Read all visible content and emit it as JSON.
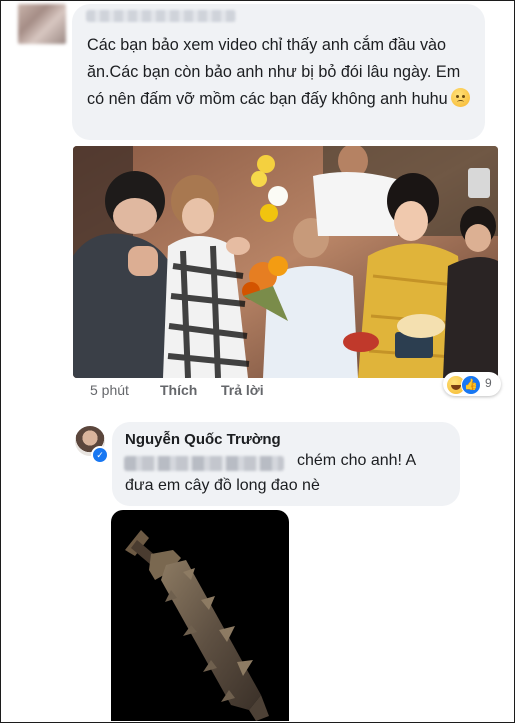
{
  "comment1": {
    "text": "Các bạn bảo xem video chỉ thấy anh cắm đầu vào ăn.Các bạn còn bảo anh như bị bỏ đói lâu ngày. Em có nên đấm vỡ mồm các bạn đấy không anh huhu",
    "emoji": "sad-face-emoji",
    "time": "5 phút",
    "like_label": "Thích",
    "reply_label": "Trả lời",
    "reaction_count": "9"
  },
  "reply": {
    "author": "Nguyễn Quốc Trường",
    "line1": "chém cho anh! A",
    "line2": "đưa em cây đồ long đao nè"
  },
  "colors": {
    "bubble": "#f0f2f5",
    "text": "#1c1e21",
    "meta": "#65676b",
    "facebook_blue": "#1877f2"
  }
}
